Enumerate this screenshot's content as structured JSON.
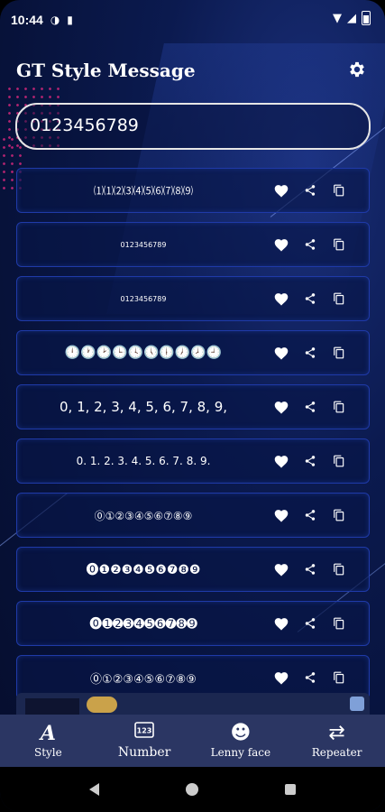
{
  "status_bar": {
    "time": "10:44"
  },
  "app_bar": {
    "title": "GT Style Message",
    "settings_icon": "gear-icon"
  },
  "input": {
    "value": "0123456789"
  },
  "styled_rows": [
    {
      "text": "⑴⑴⑵⑶⑷⑸⑹⑺⑻⑼",
      "size": 11
    },
    {
      "text": "0123456789",
      "size": 8
    },
    {
      "text": "0123456789",
      "size": 8
    },
    {
      "text": "🕛🕐🕑🕒🕓🕔🕕🕖🕗🕘",
      "size": 14
    },
    {
      "text": "0, 1, 2, 3, 4, 5, 6, 7, 8, 9,",
      "size": 15
    },
    {
      "text": "0. 1. 2. 3. 4. 5. 6. 7. 8. 9.",
      "size": 12
    },
    {
      "text": "⓪①②③④⑤⑥⑦⑧⑨",
      "size": 12
    },
    {
      "text": "⓿❶❷❸❹❺❻❼❽❾",
      "size": 14
    },
    {
      "text": "⓿➊➋➌➍➎➏➐➑➒",
      "size": 14
    },
    {
      "text": "⓪①②③④⑤⑥⑦⑧⑨",
      "size": 13
    }
  ],
  "row_actions": {
    "favorite_icon": "heart-icon",
    "share_icon": "share-icon",
    "copy_icon": "copy-icon"
  },
  "bottom_nav": [
    {
      "label": "Style",
      "icon": "style-icon"
    },
    {
      "label": "Number",
      "icon": "number-icon",
      "active": true
    },
    {
      "label": "Lenny face",
      "icon": "lenny-face-icon"
    },
    {
      "label": "Repeater",
      "icon": "repeat-icon"
    }
  ],
  "colors": {
    "accent": "#3d7fe6",
    "row_border": "#1f3aa8",
    "nav_bg": "#2b3663",
    "dots": "#d0267a"
  }
}
